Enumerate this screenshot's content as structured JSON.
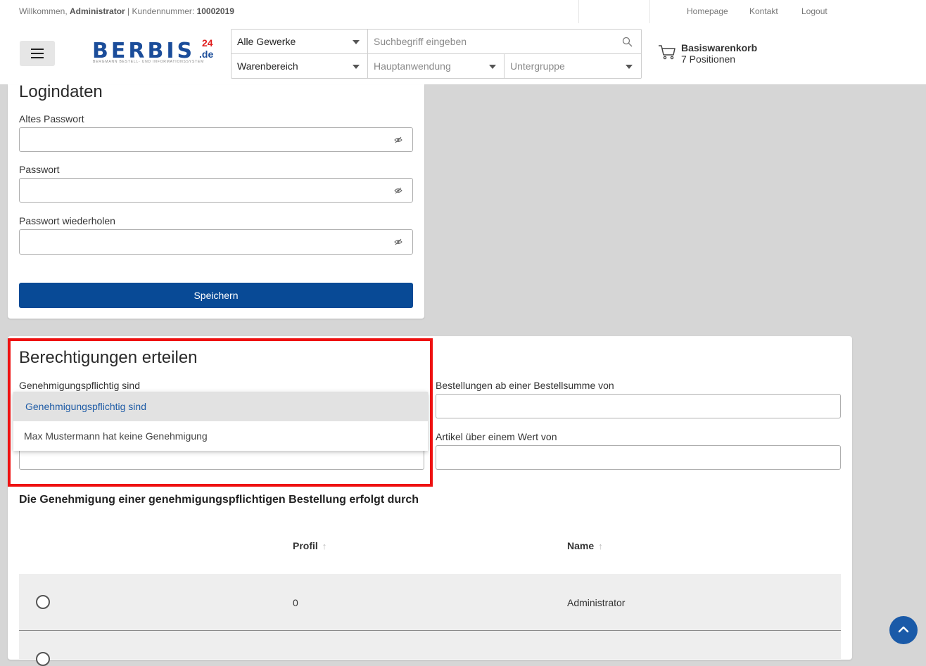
{
  "topbar": {
    "welcome_prefix": "Willkommen,",
    "user": "Administrator",
    "customer_label": "| Kundennummer:",
    "customer_number": "10002019",
    "links": [
      "Homepage",
      "Kontakt",
      "Logout"
    ]
  },
  "header": {
    "logo": {
      "main": "BERBIS",
      "number": "24",
      "tld": ".de",
      "tagline": "BERGMANN BESTELL- UND INFORMATIONSSYSTEM"
    },
    "search": {
      "trade_select": "Alle Gewerke",
      "placeholder": "Suchbegriff eingeben",
      "area_select": "Warenbereich",
      "application_select": "Hauptanwendung",
      "subgroup_select": "Untergruppe"
    },
    "cart": {
      "title": "Basiswarenkorb",
      "count": "7 Positionen"
    }
  },
  "login_card": {
    "title": "Logindaten",
    "fields": [
      {
        "label": "Altes Passwort",
        "value": ""
      },
      {
        "label": "Passwort",
        "value": ""
      },
      {
        "label": "Passwort wiederholen",
        "value": ""
      }
    ],
    "save_label": "Speichern"
  },
  "permissions_card": {
    "title": "Berechtigungen erteilen",
    "approval_label": "Genehmigungspflichtig sind",
    "dropdown_options": [
      "Genehmigungspflichtig sind",
      "Max Mustermann hat keine Genehmigung"
    ],
    "order_sum_label": "Bestellungen ab einer Bestellsumme von",
    "order_sum_value": "",
    "article_value_label": "Artikel über einem Wert von",
    "article_value_value": "",
    "approval_section_title": "Die Genehmigung einer genehmigungspflichtigen Bestellung erfolgt durch",
    "table": {
      "headers": [
        "Profil",
        "Name"
      ],
      "rows": [
        {
          "profil": "0",
          "name": "Administrator"
        }
      ]
    }
  },
  "colors": {
    "primary": "#084a96",
    "highlight_border": "#ee1111",
    "background": "#d6d6d6"
  },
  "icons": [
    "menu-icon",
    "search-icon",
    "caret-down-icon",
    "cart-icon",
    "eye-icon",
    "sort-arrow-icon",
    "chevron-up-icon"
  ]
}
